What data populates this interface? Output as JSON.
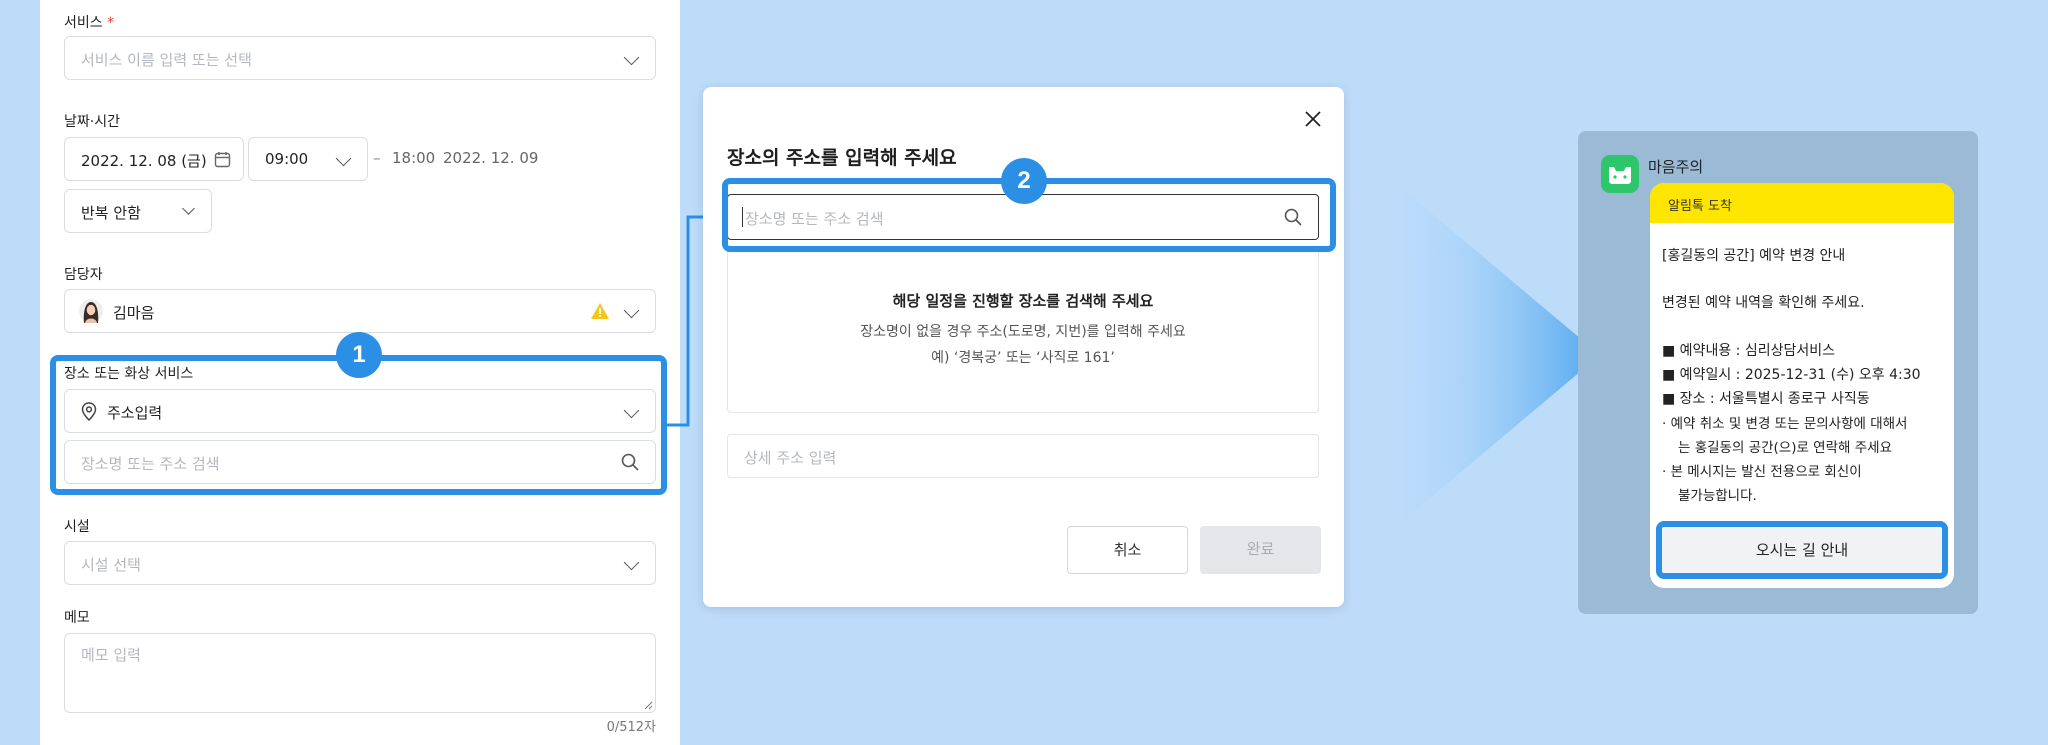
{
  "form": {
    "service": {
      "label": "서비스",
      "required_mark": "*",
      "placeholder": "서비스 이름 입력 또는 선택"
    },
    "datetime": {
      "label": "날짜·시간",
      "start_date": "2022. 12. 08 (금)",
      "start_time": "09:00",
      "separator": "–",
      "end_time": "18:00",
      "end_date": "2022. 12. 09",
      "repeat": "반복 안함"
    },
    "staff": {
      "label": "담당자",
      "name": "김마음"
    },
    "location": {
      "label": "장소 또는 화상 서비스",
      "mode": "주소입력",
      "search_placeholder": "장소명 또는 주소 검색"
    },
    "facility": {
      "label": "시설",
      "placeholder": "시설 선택"
    },
    "memo": {
      "label": "메모",
      "placeholder": "메모 입력",
      "counter": "0/512자"
    }
  },
  "modal": {
    "title": "장소의 주소를 입력해 주세요",
    "search_placeholder": "장소명 또는 주소 검색",
    "empty_title": "해당 일정을 진행할 장소를 검색해 주세요",
    "empty_desc1": "장소명이 없을 경우 주소(도로명, 지번)를 입력해 주세요",
    "empty_desc2": "예) ‘경복궁’ 또는 ‘사직로 161’",
    "detail_placeholder": "상세 주소 입력",
    "cancel": "취소",
    "confirm": "완료"
  },
  "chat": {
    "sender": "마음주의",
    "header": "알림톡 도착",
    "title": "[홍길동의 공간] 예약 변경 안내",
    "intro": "변경된 예약 내역을 확인해 주세요.",
    "items": [
      "■ 예약내용 : 심리상담서비스",
      "■ 예약일시 : 2025-12-31 (수) 오후 4:30",
      "■ 장소 : 서울특별시 종로구 사직동"
    ],
    "notes": [
      "· 예약 취소 및 변경 또는 문의사항에 대해서",
      "는 홍길동의 공간(으)로 연락해 주세요",
      "· 본 메시지는 발신 전용으로 회신이",
      "불가능합니다."
    ],
    "button": "오시는 길 안내"
  },
  "steps": [
    "1",
    "2"
  ],
  "colors": {
    "background": "#bcdcfa",
    "highlight": "#2b90e5",
    "warning": "#f5c518",
    "chat_header": "#fee500",
    "chat_bg": "#9bbad6",
    "app_icon": "#2ec66a"
  },
  "icons": [
    "calendar-icon",
    "chevron-down-icon",
    "warning-icon",
    "location-pin-icon",
    "search-icon",
    "close-icon",
    "app-logo-icon",
    "arrow-connector-icon"
  ]
}
